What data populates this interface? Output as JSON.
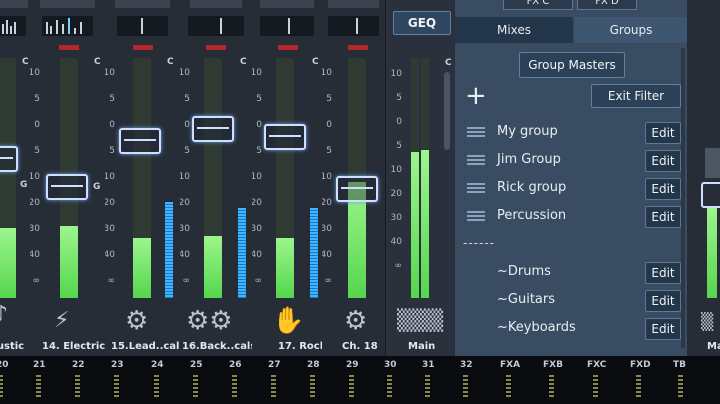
{
  "strips": [
    {
      "name": "oustic",
      "icon": "guitar-icon"
    },
    {
      "name": "14. Electric",
      "icon": "electric-guitar-icon"
    },
    {
      "name": "15.Lead..cals",
      "icon": "singer-icon"
    },
    {
      "name": "16.Back..cals",
      "icon": "singers-icon"
    },
    {
      "name": "17. Rock",
      "icon": "rock-hand-icon"
    },
    {
      "name": "Ch. 18",
      "icon": "mic-icon"
    }
  ],
  "meter_labels": {
    "c": "C",
    "g": "G"
  },
  "scale": [
    "10",
    "5",
    "0",
    "5",
    "10",
    "20",
    "30",
    "40",
    "∞"
  ],
  "main": {
    "geq": "GEQ",
    "label": "Main",
    "scale": [
      "10",
      "5",
      "0",
      "5",
      "10",
      "20",
      "30",
      "40",
      "∞"
    ],
    "c": "C"
  },
  "panel": {
    "tabs": {
      "top_left": "FX C",
      "top_right": "FX D",
      "mixes": "Mixes",
      "groups": "Groups"
    },
    "group_masters": "Group Masters",
    "exit_filter": "Exit Filter",
    "add": "+",
    "separator": "------",
    "edit": "Edit",
    "groups": [
      "My group",
      "Jim Group",
      "Rick group",
      "Percussion"
    ],
    "subgroups": [
      "~Drums",
      "~Guitars",
      "~Keyboards"
    ]
  },
  "right_strip": {
    "label": "Ma"
  },
  "bottom_numbers": [
    "20",
    "21",
    "22",
    "23",
    "24",
    "25",
    "26",
    "27",
    "28",
    "29",
    "30",
    "31",
    "32",
    "FXA",
    "FXB",
    "FXC",
    "FXD",
    "TB"
  ],
  "colors": {
    "meter_green": "#5bdc50",
    "meter_blue": "#3fb6ff",
    "panel_bg": "#3a4c61",
    "mute_red": "#b3262a"
  }
}
